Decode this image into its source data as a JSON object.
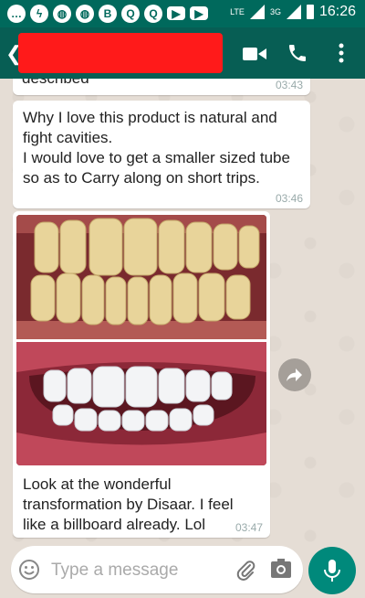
{
  "status_bar": {
    "time": "16:26",
    "network_lte": "LTE",
    "network_3g": "3G",
    "notification_icons": [
      "chat-bubble-icon",
      "messenger-icon",
      "globe-icon",
      "globe-icon",
      "bbm-icon",
      "q-icon",
      "q-icon",
      "youtube-icon",
      "youtube-icon"
    ]
  },
  "header": {
    "back_icon": "back-arrow-icon",
    "contact_name": "",
    "actions": [
      "video-call-icon",
      "phone-call-icon",
      "more-vert-icon"
    ]
  },
  "messages": [
    {
      "text": "described",
      "time": "03:43"
    },
    {
      "text": "Why I love this product is natural and fight cavities.\nI would love to get a smaller sized tube so as to Carry along on short trips.",
      "time": "03:46"
    },
    {
      "image": "teeth-before-after-photo",
      "caption": "Look at the wonderful transformation by Disaar. I feel like a billboard already. Lol",
      "time": "03:47"
    }
  ],
  "input": {
    "placeholder": "Type a message"
  },
  "colors": {
    "status_bar": "#00695c",
    "app_bar": "#075e54",
    "chat_bg": "#e5ddd5",
    "mic_button": "#00897b",
    "redaction": "#ff1a1a"
  }
}
